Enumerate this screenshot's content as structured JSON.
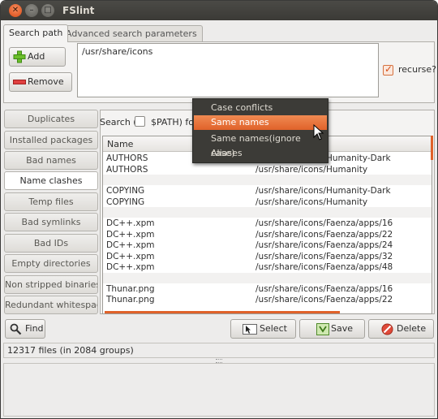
{
  "window": {
    "title": "FSlint"
  },
  "tabs": [
    {
      "label": "Search path",
      "active": true
    },
    {
      "label": "Advanced search parameters",
      "active": false
    }
  ],
  "search_path": {
    "add_label": "Add",
    "remove_label": "Remove",
    "paths": [
      "/usr/share/icons"
    ],
    "recurse_label": "recurse?",
    "recurse_checked": true
  },
  "sidebar": {
    "items": [
      {
        "label": "Duplicates"
      },
      {
        "label": "Installed packages"
      },
      {
        "label": "Bad names"
      },
      {
        "label": "Name clashes",
        "active": true
      },
      {
        "label": "Temp files"
      },
      {
        "label": "Bad symlinks"
      },
      {
        "label": "Bad IDs"
      },
      {
        "label": "Empty directories"
      },
      {
        "label": "Non stripped binaries"
      },
      {
        "label": "Redundant whitespace"
      }
    ]
  },
  "search_bar": {
    "prefix": "Search (",
    "path_label": "$PATH) for",
    "path_checked": false
  },
  "results": {
    "columns": [
      "Name",
      ""
    ],
    "rows": [
      [
        "AUTHORS",
        "/usr/share/icons/Humanity-Dark"
      ],
      [
        "AUTHORS",
        "/usr/share/icons/Humanity"
      ],
      [
        "",
        ""
      ],
      [
        "COPYING",
        "/usr/share/icons/Humanity-Dark"
      ],
      [
        "COPYING",
        "/usr/share/icons/Humanity"
      ],
      [
        "",
        ""
      ],
      [
        "DC++.xpm",
        "/usr/share/icons/Faenza/apps/16"
      ],
      [
        "DC++.xpm",
        "/usr/share/icons/Faenza/apps/22"
      ],
      [
        "DC++.xpm",
        "/usr/share/icons/Faenza/apps/24"
      ],
      [
        "DC++.xpm",
        "/usr/share/icons/Faenza/apps/32"
      ],
      [
        "DC++.xpm",
        "/usr/share/icons/Faenza/apps/48"
      ],
      [
        "",
        ""
      ],
      [
        "Thunar.png",
        "/usr/share/icons/Faenza/apps/16"
      ],
      [
        "Thunar.png",
        "/usr/share/icons/Faenza/apps/22"
      ]
    ]
  },
  "dropdown": {
    "items": [
      "Case conflicts",
      "Same names",
      "Same names(ignore case)",
      "Aliases"
    ],
    "selected_index": 1
  },
  "actions": {
    "find": "Find",
    "select": "Select",
    "save": "Save",
    "delete": "Delete"
  },
  "status": {
    "text": "12317 files (in 2084 groups)"
  },
  "colors": {
    "accent": "#e0622a",
    "titlebar": "#3c3b37",
    "window_bg": "#edeceb"
  }
}
